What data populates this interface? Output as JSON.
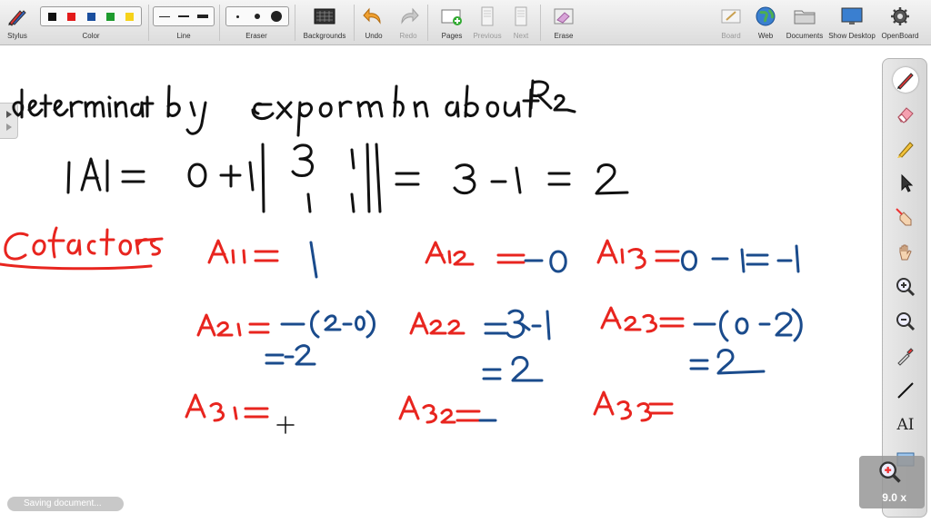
{
  "toolbar": {
    "stylus": "Stylus",
    "color": "Color",
    "line": "Line",
    "eraser": "Eraser",
    "backgrounds": "Backgrounds",
    "undo": "Undo",
    "redo": "Redo",
    "pages": "Pages",
    "previous": "Previous",
    "next": "Next",
    "erase": "Erase",
    "board": "Board",
    "web": "Web",
    "documents": "Documents",
    "show_desktop": "Show Desktop",
    "openboard": "OpenBoard"
  },
  "colors": [
    "#111111",
    "#e31b1b",
    "#1b4f9e",
    "#1e9b2e",
    "#f6d21a"
  ],
  "ink_colors": {
    "black": "#111111",
    "red": "#e8251f",
    "blue": "#1a4b8c"
  },
  "side_icons": [
    "pen-icon",
    "eraser-icon",
    "marker-icon",
    "pointer-icon",
    "laser-hand-icon",
    "hand-icon",
    "zoom-in-icon",
    "zoom-out-icon",
    "pipette-icon",
    "line-icon",
    "text-icon",
    "capture-icon"
  ],
  "side_text_label": "AI",
  "zoom": {
    "value": "9.0 x"
  },
  "status": {
    "text": "Saving document..."
  }
}
